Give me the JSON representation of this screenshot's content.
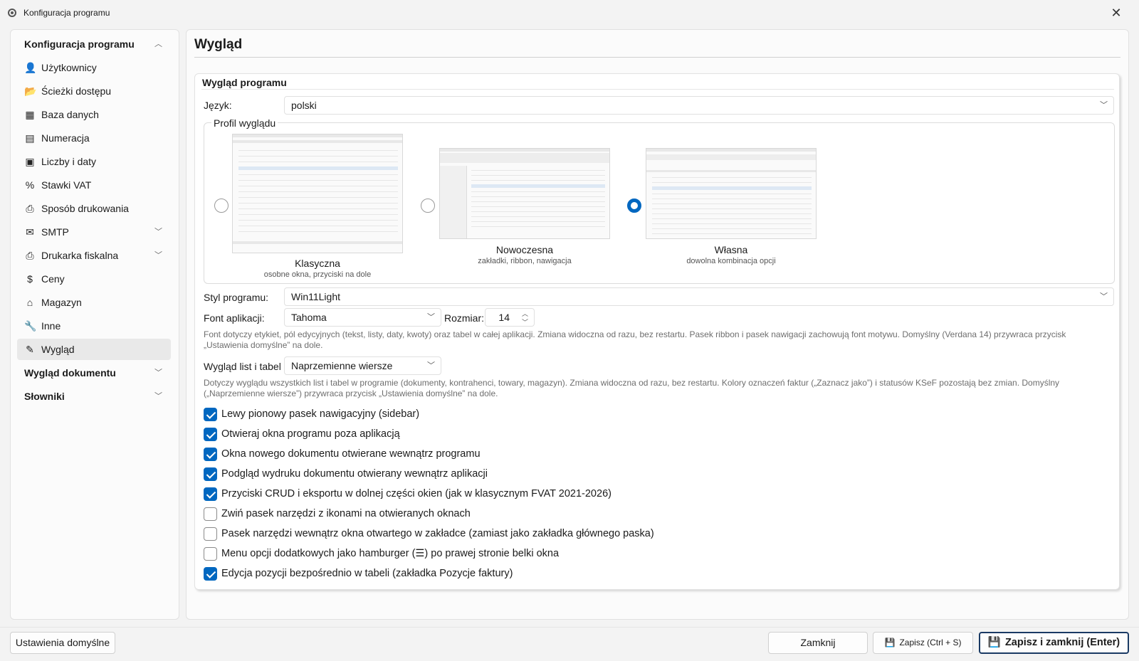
{
  "window": {
    "title": "Konfiguracja programu",
    "close_glyph": "✕",
    "app_icon": "gear-people-icon"
  },
  "sidebar": {
    "group_config": {
      "label": "Konfiguracja programu",
      "chevron": "︿"
    },
    "items": [
      {
        "label": "Użytkownicy",
        "icon": "user-icon",
        "glyph": "👤"
      },
      {
        "label": "Ścieżki dostępu",
        "icon": "folder-open-icon",
        "glyph": "📂"
      },
      {
        "label": "Baza danych",
        "icon": "table-icon",
        "glyph": "▦"
      },
      {
        "label": "Numeracja",
        "icon": "document-list-icon",
        "glyph": "▤"
      },
      {
        "label": "Liczby i daty",
        "icon": "calendar-icon",
        "glyph": "▣"
      },
      {
        "label": "Stawki VAT",
        "icon": "percent-icon",
        "glyph": "%"
      },
      {
        "label": "Sposób drukowania",
        "icon": "printer-icon",
        "glyph": "⎙"
      },
      {
        "label": "SMTP",
        "icon": "envelope-icon",
        "glyph": "✉"
      },
      {
        "label": "Drukarka fiskalna",
        "icon": "printer-icon",
        "glyph": "⎙"
      },
      {
        "label": "Ceny",
        "icon": "dollar-icon",
        "glyph": "$"
      },
      {
        "label": "Magazyn",
        "icon": "warehouse-icon",
        "glyph": "⌂"
      },
      {
        "label": "Inne",
        "icon": "wrench-icon",
        "glyph": "🔧"
      },
      {
        "label": "Wygląd",
        "icon": "pencil-icon",
        "glyph": "✎"
      }
    ],
    "group_document": {
      "label": "Wygląd dokumentu",
      "chevron": "﹀"
    },
    "group_dict": {
      "label": "Słowniki",
      "chevron": "﹀"
    },
    "smtp_chevron": "﹀",
    "fiscal_chevron": "﹀"
  },
  "main": {
    "page_title": "Wygląd",
    "section_title": "Wygląd programu",
    "language": {
      "label": "Język:",
      "value": "polski"
    },
    "profile": {
      "legend": "Profil wyglądu",
      "options": [
        {
          "name": "Klasyczna",
          "desc": "osobne okna, przyciski na dole",
          "selected": false
        },
        {
          "name": "Nowoczesna",
          "desc": "zakładki, ribbon, nawigacja",
          "selected": false
        },
        {
          "name": "Własna",
          "desc": "dowolna kombinacja opcji",
          "selected": true
        }
      ]
    },
    "style": {
      "label": "Styl programu:",
      "value": "Win11Light"
    },
    "font": {
      "label": "Font aplikacji:",
      "value": "Tahoma",
      "size_label": "Rozmiar:",
      "size_value": "14"
    },
    "font_hint": "Font dotyczy etykiet, pól edycyjnych (tekst, listy, daty, kwoty) oraz tabel w całej aplikacji. Zmiana widoczna od razu, bez restartu. Pasek ribbon i pasek nawigacji zachowują font motywu. Domyślny (Verdana 14) przywraca przycisk „Ustawienia domyślne” na dole.",
    "lists": {
      "label": "Wygląd list i tabel",
      "value": "Naprzemienne wiersze"
    },
    "lists_hint": "Dotyczy wyglądu wszystkich list i tabel w programie (dokumenty, kontrahenci, towary, magazyn). Zmiana widoczna od razu, bez restartu. Kolory oznaczeń faktur („Zaznacz jako”) i statusów KSeF pozostają bez zmian. Domyślny („Naprzemienne wiersze”) przywraca przycisk „Ustawienia domyślne” na dole.",
    "checkboxes": [
      {
        "label": "Lewy pionowy pasek nawigacyjny (sidebar)",
        "checked": true
      },
      {
        "label": "Otwieraj okna programu poza aplikacją",
        "checked": true
      },
      {
        "label": "Okna nowego dokumentu otwierane wewnątrz programu",
        "checked": true
      },
      {
        "label": "Podgląd wydruku dokumentu otwierany wewnątrz aplikacji",
        "checked": true
      },
      {
        "label": "Przyciski CRUD i eksportu w dolnej części okien (jak w klasycznym FVAT 2021-2026)",
        "checked": true
      },
      {
        "label": "Zwiń pasek narzędzi z ikonami na otwieranych oknach",
        "checked": false
      },
      {
        "label": "Pasek narzędzi wewnątrz okna otwartego w zakładce (zamiast jako zakładka głównego paska)",
        "checked": false
      },
      {
        "label": "Menu opcji dodatkowych jako hamburger (☰) po prawej stronie belki okna",
        "checked": false
      },
      {
        "label": "Edycja pozycji bezpośrednio w tabeli (zakładka Pozycje faktury)",
        "checked": true
      }
    ]
  },
  "footer": {
    "defaults": "Ustawienia domyślne",
    "close": "Zamknij",
    "save": "Zapisz (Ctrl + S)",
    "save_close": "Zapisz i zamknij (Enter)",
    "save_icon": "💾",
    "save_close_icon": "💾"
  },
  "colors": {
    "accent": "#0067c0",
    "primary_border": "#1a3a64"
  }
}
